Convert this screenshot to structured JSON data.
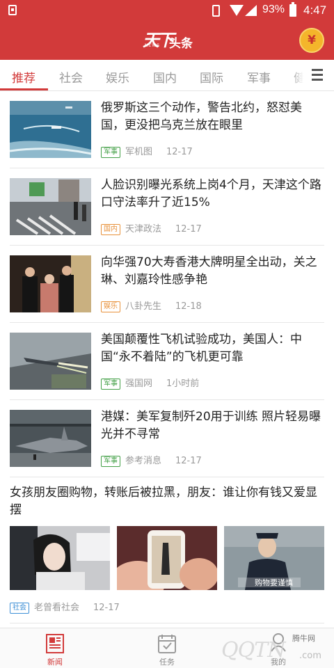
{
  "status_bar": {
    "battery": "93%",
    "time": "4:47"
  },
  "header": {
    "logo_text_big": "天下",
    "logo_text_small": "头条",
    "logo_sub": "NEWS",
    "coin_symbol": "¥"
  },
  "tabs": [
    {
      "label": "推荐",
      "active": true
    },
    {
      "label": "社会"
    },
    {
      "label": "娱乐"
    },
    {
      "label": "国内"
    },
    {
      "label": "国际"
    },
    {
      "label": "军事"
    },
    {
      "label": "健"
    }
  ],
  "news": [
    {
      "title": "俄罗斯这三个动作，警告北约，怒怼美国，更没把乌克兰放在眼里",
      "badge": "军事",
      "badge_color": "#43a047",
      "source": "军机图",
      "time": "12-17"
    },
    {
      "title": "人脸识别曝光系统上岗4个月，天津这个路口守法率升了近15%",
      "badge": "国内",
      "badge_color": "#e8913a",
      "source": "天津政法",
      "time": "12-17"
    },
    {
      "title": "向华强70大寿香港大牌明星全出动，关之琳、刘嘉玲性感争艳",
      "badge": "娱乐",
      "badge_color": "#e8913a",
      "source": "八卦先生",
      "time": "12-18"
    },
    {
      "title": "美国颠覆性飞机试验成功，美国人：中国“永不着陆”的飞机更可靠",
      "badge": "军事",
      "badge_color": "#43a047",
      "source": "强国网",
      "time": "1小时前"
    },
    {
      "title": "港媒：美军复制歼20用于训练 照片轻易曝光并不寻常",
      "badge": "军事",
      "badge_color": "#43a047",
      "source": "参考消息",
      "time": "12-17"
    }
  ],
  "feature": {
    "title": "女孩朋友圈购物，转账后被拉黑，朋友：谁让你有钱又爱显摆",
    "image_caption": "购物要谨慎",
    "badge": "社会",
    "badge_color": "#3d8fd6",
    "source": "老曾看社会",
    "time": "12-17"
  },
  "bottom_nav": [
    {
      "label": "新闻",
      "active": true
    },
    {
      "label": "任务"
    },
    {
      "label": "我的"
    }
  ],
  "watermark": {
    "small": "腾牛网",
    "big": "QQTN",
    "com": ".com"
  },
  "colors": {
    "brand": "#d23a3a",
    "coin": "#f4b52b"
  }
}
